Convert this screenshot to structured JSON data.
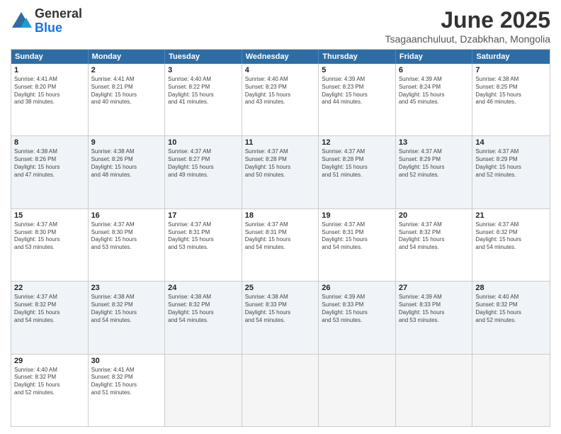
{
  "header": {
    "logo_general": "General",
    "logo_blue": "Blue",
    "month_title": "June 2025",
    "location": "Tsagaanchuluut, Dzabkhan, Mongolia"
  },
  "days_of_week": [
    "Sunday",
    "Monday",
    "Tuesday",
    "Wednesday",
    "Thursday",
    "Friday",
    "Saturday"
  ],
  "weeks": [
    [
      {
        "day": "1",
        "info": "Sunrise: 4:41 AM\nSunset: 8:20 PM\nDaylight: 15 hours\nand 38 minutes."
      },
      {
        "day": "2",
        "info": "Sunrise: 4:41 AM\nSunset: 8:21 PM\nDaylight: 15 hours\nand 40 minutes."
      },
      {
        "day": "3",
        "info": "Sunrise: 4:40 AM\nSunset: 8:22 PM\nDaylight: 15 hours\nand 41 minutes."
      },
      {
        "day": "4",
        "info": "Sunrise: 4:40 AM\nSunset: 8:23 PM\nDaylight: 15 hours\nand 43 minutes."
      },
      {
        "day": "5",
        "info": "Sunrise: 4:39 AM\nSunset: 8:23 PM\nDaylight: 15 hours\nand 44 minutes."
      },
      {
        "day": "6",
        "info": "Sunrise: 4:39 AM\nSunset: 8:24 PM\nDaylight: 15 hours\nand 45 minutes."
      },
      {
        "day": "7",
        "info": "Sunrise: 4:38 AM\nSunset: 8:25 PM\nDaylight: 15 hours\nand 46 minutes."
      }
    ],
    [
      {
        "day": "8",
        "info": "Sunrise: 4:38 AM\nSunset: 8:26 PM\nDaylight: 15 hours\nand 47 minutes."
      },
      {
        "day": "9",
        "info": "Sunrise: 4:38 AM\nSunset: 8:26 PM\nDaylight: 15 hours\nand 48 minutes."
      },
      {
        "day": "10",
        "info": "Sunrise: 4:37 AM\nSunset: 8:27 PM\nDaylight: 15 hours\nand 49 minutes."
      },
      {
        "day": "11",
        "info": "Sunrise: 4:37 AM\nSunset: 8:28 PM\nDaylight: 15 hours\nand 50 minutes."
      },
      {
        "day": "12",
        "info": "Sunrise: 4:37 AM\nSunset: 8:28 PM\nDaylight: 15 hours\nand 51 minutes."
      },
      {
        "day": "13",
        "info": "Sunrise: 4:37 AM\nSunset: 8:29 PM\nDaylight: 15 hours\nand 52 minutes."
      },
      {
        "day": "14",
        "info": "Sunrise: 4:37 AM\nSunset: 8:29 PM\nDaylight: 15 hours\nand 52 minutes."
      }
    ],
    [
      {
        "day": "15",
        "info": "Sunrise: 4:37 AM\nSunset: 8:30 PM\nDaylight: 15 hours\nand 53 minutes."
      },
      {
        "day": "16",
        "info": "Sunrise: 4:37 AM\nSunset: 8:30 PM\nDaylight: 15 hours\nand 53 minutes."
      },
      {
        "day": "17",
        "info": "Sunrise: 4:37 AM\nSunset: 8:31 PM\nDaylight: 15 hours\nand 53 minutes."
      },
      {
        "day": "18",
        "info": "Sunrise: 4:37 AM\nSunset: 8:31 PM\nDaylight: 15 hours\nand 54 minutes."
      },
      {
        "day": "19",
        "info": "Sunrise: 4:37 AM\nSunset: 8:31 PM\nDaylight: 15 hours\nand 54 minutes."
      },
      {
        "day": "20",
        "info": "Sunrise: 4:37 AM\nSunset: 8:32 PM\nDaylight: 15 hours\nand 54 minutes."
      },
      {
        "day": "21",
        "info": "Sunrise: 4:37 AM\nSunset: 8:32 PM\nDaylight: 15 hours\nand 54 minutes."
      }
    ],
    [
      {
        "day": "22",
        "info": "Sunrise: 4:37 AM\nSunset: 8:32 PM\nDaylight: 15 hours\nand 54 minutes."
      },
      {
        "day": "23",
        "info": "Sunrise: 4:38 AM\nSunset: 8:32 PM\nDaylight: 15 hours\nand 54 minutes."
      },
      {
        "day": "24",
        "info": "Sunrise: 4:38 AM\nSunset: 8:32 PM\nDaylight: 15 hours\nand 54 minutes."
      },
      {
        "day": "25",
        "info": "Sunrise: 4:38 AM\nSunset: 8:33 PM\nDaylight: 15 hours\nand 54 minutes."
      },
      {
        "day": "26",
        "info": "Sunrise: 4:39 AM\nSunset: 8:33 PM\nDaylight: 15 hours\nand 53 minutes."
      },
      {
        "day": "27",
        "info": "Sunrise: 4:39 AM\nSunset: 8:33 PM\nDaylight: 15 hours\nand 53 minutes."
      },
      {
        "day": "28",
        "info": "Sunrise: 4:40 AM\nSunset: 8:32 PM\nDaylight: 15 hours\nand 52 minutes."
      }
    ],
    [
      {
        "day": "29",
        "info": "Sunrise: 4:40 AM\nSunset: 8:32 PM\nDaylight: 15 hours\nand 52 minutes."
      },
      {
        "day": "30",
        "info": "Sunrise: 4:41 AM\nSunset: 8:32 PM\nDaylight: 15 hours\nand 51 minutes."
      },
      {
        "day": "",
        "info": ""
      },
      {
        "day": "",
        "info": ""
      },
      {
        "day": "",
        "info": ""
      },
      {
        "day": "",
        "info": ""
      },
      {
        "day": "",
        "info": ""
      }
    ]
  ]
}
